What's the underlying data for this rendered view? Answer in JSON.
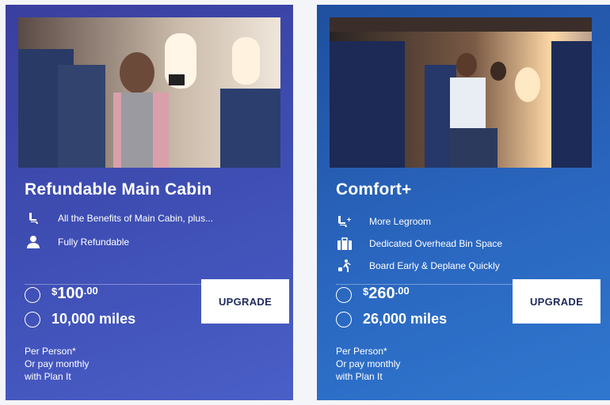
{
  "cards": [
    {
      "title": "Refundable Main Cabin",
      "features": [
        {
          "icon": "seat-icon",
          "label": "All the Benefits of Main Cabin, plus..."
        },
        {
          "icon": "person-icon",
          "label": "Fully Refundable"
        }
      ],
      "price_whole": "100",
      "price_cents": ".00",
      "currency": "$",
      "miles": "10,000 miles",
      "upgrade_label": "UPGRADE",
      "fine_1": "Per Person*",
      "fine_2": "Or pay monthly",
      "fine_3": "with Plan It",
      "colors": {
        "background": "#3f4fb5"
      }
    },
    {
      "title": "Comfort+",
      "features": [
        {
          "icon": "seat-plus-icon",
          "label": "More Legroom"
        },
        {
          "icon": "luggage-icon",
          "label": "Dedicated Overhead Bin Space"
        },
        {
          "icon": "walking-luggage-icon",
          "label": "Board Early & Deplane Quickly"
        }
      ],
      "price_whole": "260",
      "price_cents": ".00",
      "currency": "$",
      "miles": "26,000 miles",
      "upgrade_label": "UPGRADE",
      "fine_1": "Per Person*",
      "fine_2": "Or pay monthly",
      "fine_3": "with Plan It",
      "colors": {
        "background": "#2a66bf"
      }
    }
  ]
}
